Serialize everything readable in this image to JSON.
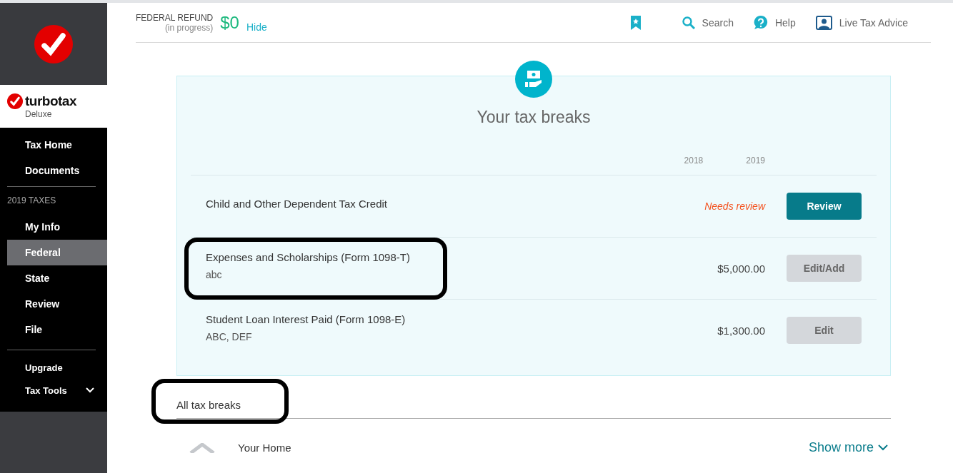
{
  "sidebar": {
    "brand": {
      "name": "turbotax",
      "edition": "Deluxe"
    },
    "top_items": [
      {
        "label": "Tax Home",
        "selected": false
      },
      {
        "label": "Documents",
        "selected": false
      }
    ],
    "section_label": "2019 TAXES",
    "items": [
      {
        "label": "My Info",
        "selected": false
      },
      {
        "label": "Federal",
        "selected": true
      },
      {
        "label": "State",
        "selected": false
      },
      {
        "label": "Review",
        "selected": false
      },
      {
        "label": "File",
        "selected": false
      }
    ],
    "bottom_items": [
      {
        "label": "Upgrade",
        "kind": "link"
      },
      {
        "label": "Tax Tools",
        "kind": "dropdown"
      }
    ]
  },
  "header": {
    "refund_label": "FEDERAL REFUND",
    "refund_note": "(in progress)",
    "refund_amount": "$0",
    "hide_link": "Hide",
    "actions": [
      {
        "kind": "bookmark"
      },
      {
        "kind": "search",
        "label": "Search"
      },
      {
        "kind": "help",
        "label": "Help"
      },
      {
        "kind": "advice",
        "label": "Live Tax Advice"
      }
    ]
  },
  "tax_breaks": {
    "title": "Your tax breaks",
    "columns": [
      "2018",
      "2019"
    ],
    "items": [
      {
        "name": "Child and Other Dependent Tax Credit",
        "status": "Needs review",
        "button": "Review",
        "primary": true,
        "highlighted": false
      },
      {
        "name": "Expenses and Scholarships (Form 1098-T)",
        "detail": "abc",
        "amount_2019": "$5,000.00",
        "button": "Edit/Add",
        "primary": false,
        "highlighted": true
      },
      {
        "name": "Student Loan Interest Paid (Form 1098-E)",
        "detail": "ABC, DEF",
        "amount_2019": "$1,300.00",
        "button": "Edit",
        "primary": false,
        "highlighted": false
      }
    ]
  },
  "all_tax_breaks": {
    "heading": "All tax breaks",
    "highlighted": true,
    "categories": [
      {
        "name": "Your Home",
        "action": "Show more"
      }
    ]
  }
}
